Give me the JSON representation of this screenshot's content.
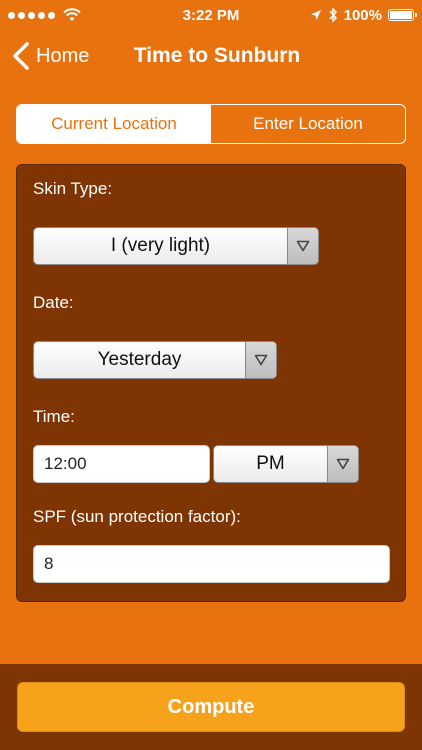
{
  "status_bar": {
    "time": "3:22 PM",
    "battery": "100%",
    "battery_level": 1.0
  },
  "nav": {
    "back_label": "Home",
    "title": "Time to Sunburn"
  },
  "location_tabs": [
    {
      "label": "Current Location",
      "selected": true
    },
    {
      "label": "Enter Location",
      "selected": false
    }
  ],
  "form": {
    "skin_type": {
      "label": "Skin Type:",
      "value": "I (very light)"
    },
    "date": {
      "label": "Date:",
      "value": "Yesterday"
    },
    "time": {
      "label": "Time:",
      "value": "12:00",
      "ampm": "PM"
    },
    "spf": {
      "label": "SPF (sun protection factor):",
      "value": "8"
    }
  },
  "actions": {
    "compute_label": "Compute"
  },
  "colors": {
    "background": "#E8720E",
    "panel": "#7E3503",
    "button": "#F7A21B"
  }
}
